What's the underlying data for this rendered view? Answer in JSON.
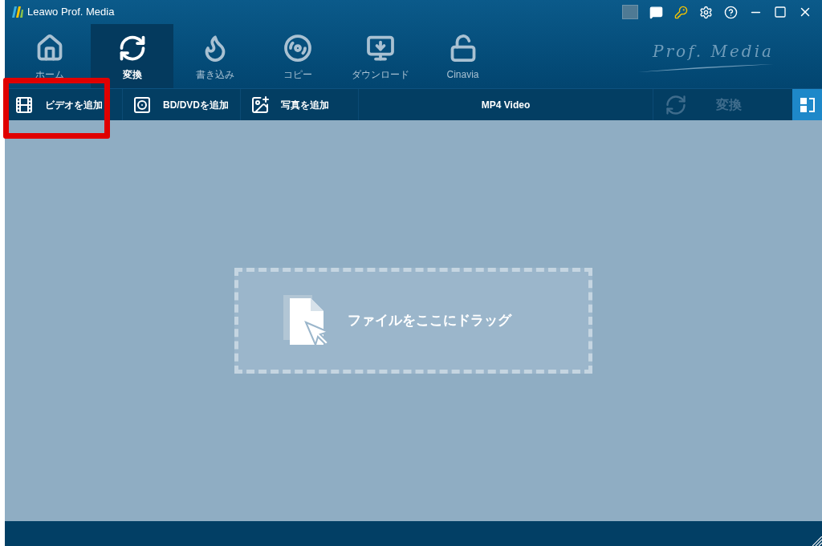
{
  "window": {
    "title": "Leawo Prof. Media"
  },
  "nav_tabs": [
    {
      "label": "ホーム",
      "selected": false,
      "kind": "home"
    },
    {
      "label": "変換",
      "selected": true,
      "kind": "convert"
    },
    {
      "label": "書き込み",
      "selected": false,
      "kind": "burn"
    },
    {
      "label": "コピー",
      "selected": false,
      "kind": "copy"
    },
    {
      "label": "ダウンロード",
      "selected": false,
      "kind": "download"
    },
    {
      "label": "Cinavia",
      "selected": false,
      "kind": "cinavia"
    }
  ],
  "brand": "Prof. Media",
  "toolbar": {
    "buttons": [
      {
        "label": "ビデオを追加",
        "kind": "video"
      },
      {
        "label": "BD/DVDを追加",
        "kind": "disc"
      },
      {
        "label": "写真を追加",
        "kind": "photo"
      }
    ],
    "profile": "MP4 Video",
    "convert": {
      "label": "変換",
      "disabled": true
    }
  },
  "drop_zone": {
    "text": "ファイルをここにドラッグ"
  },
  "annotation": {
    "kind": "red_frame"
  }
}
